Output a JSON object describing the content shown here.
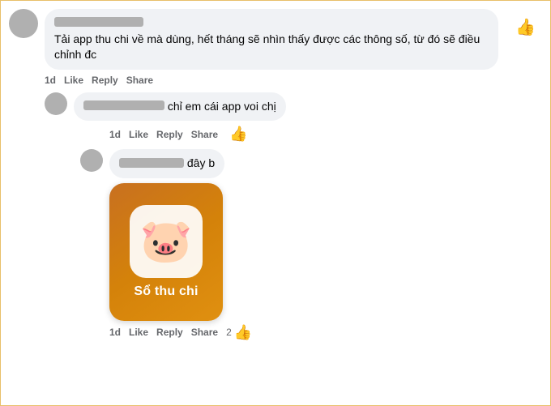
{
  "comments": [
    {
      "id": "comment1",
      "avatar": "gray",
      "username_width": 110,
      "text": "Tải app thu chi về mà dùng, hết tháng sẽ nhìn thấy được các thông số, từ đó sẽ điều chỉnh đc",
      "time": "1d",
      "actions": [
        "Like",
        "Reply",
        "Share"
      ],
      "likes": 1,
      "replies": [
        {
          "id": "reply1",
          "avatar": "gray",
          "username_width": 100,
          "text": " chỉ em cái app voi chị",
          "time": "1d",
          "actions": [
            "Like",
            "Reply",
            "Share"
          ],
          "likes": 1,
          "replies": [
            {
              "id": "reply2",
              "avatar": "gray",
              "username_width": 80,
              "text": " đây b",
              "time": "1d",
              "actions": [
                "Like",
                "Reply",
                "Share"
              ],
              "likes": 2,
              "has_image": true,
              "image_label": "Sổ thu chi"
            }
          ]
        }
      ]
    }
  ],
  "app": {
    "name": "Sổ thu chi"
  },
  "actions": {
    "like": "Like",
    "reply": "Reply",
    "share": "Share"
  }
}
